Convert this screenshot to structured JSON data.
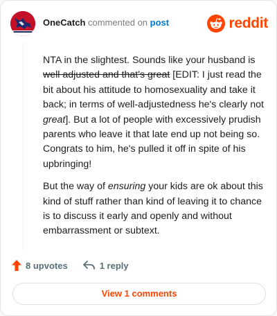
{
  "header": {
    "username": "OneCatch",
    "verb": "commented on",
    "post_link": "post",
    "brand": "reddit"
  },
  "comment": {
    "p1": {
      "a": "NTA in the slightest. Sounds like your husband is ",
      "struck": "well adjusted and that's great",
      "b": " [EDIT: I just read the bit about his attitude to homosexuality and take it back; in terms of well-adjustedness he's clearly not ",
      "em": "great",
      "c": "]. But a lot of people with excessively prudish parents who leave it that late end up not being so. Congrats to him, he's pulled it off in spite of his upbringing!"
    },
    "p2": {
      "a": "But the way of ",
      "em": "ensuring",
      "b": " your kids are ok about this kind of stuff rather than kind of leaving it to chance is to discuss it early and openly and without embarrassment or subtext."
    }
  },
  "actions": {
    "upvotes": "8 upvotes",
    "reply": "1 reply"
  },
  "view_comments": "View 1 comments",
  "colors": {
    "brand": "#ff4500",
    "link": "#0079d3",
    "muted": "#576f76"
  },
  "icons": {
    "avatar": "avatar",
    "logo": "reddit-snoo-icon",
    "upvote": "upvote-arrow-icon",
    "reply": "reply-arrow-icon"
  }
}
